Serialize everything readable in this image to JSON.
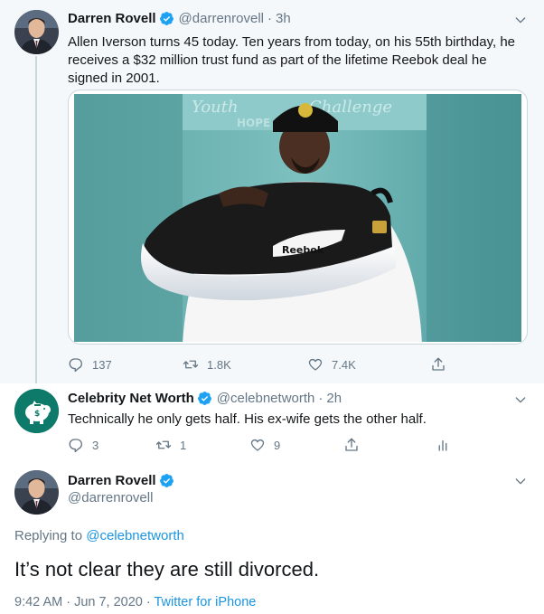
{
  "tweet1": {
    "name": "Darren Rovell",
    "handle": "@darrenrovell",
    "time": "3h",
    "text": "Allen Iverson turns 45 today. Ten years from today, on his 55th birthday, he receives a $32 million trust fund as part of the lifetime Reebok deal he signed in 2001.",
    "image_sign_text": "Youth Challenge",
    "image_sign_text2": "HOPE CENTER",
    "replies": "137",
    "retweets": "1.8K",
    "likes": "7.4K"
  },
  "tweet2": {
    "name": "Celebrity Net Worth",
    "handle": "@celebnetworth",
    "time": "2h",
    "text": "Technically he only gets half. His ex-wife gets the other half.",
    "replies": "3",
    "retweets": "1",
    "likes": "9"
  },
  "tweet3": {
    "name": "Darren Rovell",
    "handle": "@darrenrovell",
    "replying_label": "Replying to",
    "replying_handle": "@celebnetworth",
    "text": "It’s not clear they are still divorced.",
    "timestamp": "9:42 AM · Jun 7, 2020 · ",
    "source": "Twitter for iPhone"
  },
  "colors": {
    "accent": "#1da1f2",
    "secondary_text": "#657786",
    "link": "#1b95e0",
    "celeb_avatar_bg": "#0e7a6a"
  },
  "icons": [
    "chevron-down-icon",
    "verified-badge-icon",
    "reply-icon",
    "retweet-icon",
    "like-icon",
    "share-icon",
    "analytics-icon",
    "piggy-bank-icon"
  ]
}
